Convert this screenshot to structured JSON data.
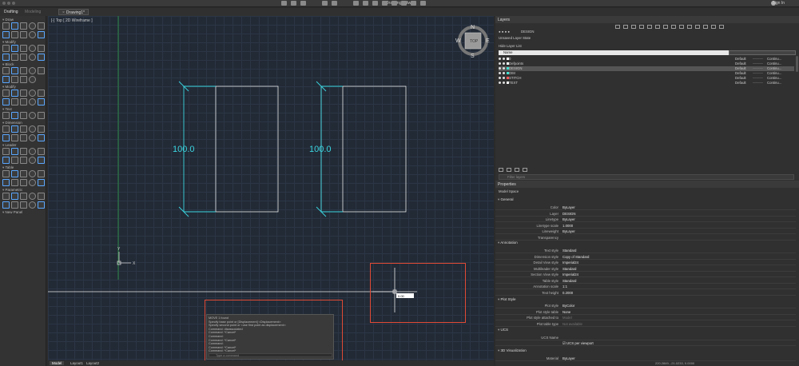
{
  "window": {
    "title": "Drawing1.dwg",
    "sign_in": "Sign In"
  },
  "workspace_tabs": [
    "Drafting",
    "Modeling"
  ],
  "document_tab": "Drawing1*",
  "viewport_label": "[-] Top [ 2D Wireframe ]",
  "viewcube": {
    "face": "TOP",
    "north": "N",
    "south": "S",
    "east": "E",
    "west": "W"
  },
  "dimensions": [
    {
      "text": "100.0"
    },
    {
      "text": "100.0"
    }
  ],
  "ucs": {
    "x": "X",
    "y": "Y"
  },
  "cursor_tooltip": "0.00",
  "tool_palette": {
    "sections": [
      "Draw",
      "Modify",
      "Block",
      "Modify",
      "Text",
      "Dimension",
      "Leader",
      "Table",
      "Parametric",
      "New Panel"
    ]
  },
  "command_history": [
    "MOVE 1 found",
    "Specify base point or [Displacement] <Displacement>:",
    "Specify second point or <use first point as displacement>:",
    "Command: disassociated",
    "Command: *Cancel*",
    "Command:",
    "Command: *Cancel*",
    "Command:",
    "Command: *Cancel*",
    "Command: *Cancel*",
    "Command: *Cancel*"
  ],
  "command_placeholder": "Type a command",
  "layout_tabs": [
    "Model",
    "Layout1",
    "Layout2"
  ],
  "layers": {
    "title": "Layers",
    "current_layer": "DESIGN",
    "unsaved_state": "Unsaved Layer State",
    "hide_layer_list": "Hide Layer List",
    "column_name": "Name",
    "search_placeholder": "Filter layers",
    "rows": [
      {
        "name": "0",
        "linetype": "Default",
        "style": "Continu...",
        "selected": false,
        "color": "#ffffff"
      },
      {
        "name": "Defpoints",
        "linetype": "Default",
        "style": "Continu...",
        "selected": false,
        "color": "#ffffff"
      },
      {
        "name": "DESIGN",
        "linetype": "Default",
        "style": "Continu...",
        "selected": true,
        "color": "#40e0d0"
      },
      {
        "name": "DIM",
        "linetype": "Default",
        "style": "Continu...",
        "selected": false,
        "color": "#40e0d0"
      },
      {
        "name": "STITCH",
        "linetype": "Default",
        "style": "Continu...",
        "selected": false,
        "color": "#ff5555"
      },
      {
        "name": "TEXT",
        "linetype": "Default",
        "style": "Continu...",
        "selected": false,
        "color": "#ffffff"
      }
    ]
  },
  "properties": {
    "title": "Properties",
    "context": "Model Space",
    "general_title": "General",
    "general": [
      {
        "label": "Color",
        "value": "ByLayer"
      },
      {
        "label": "Layer",
        "value": "DESIGN"
      },
      {
        "label": "Linetype",
        "value": "ByLayer"
      },
      {
        "label": "Linetype scale",
        "value": "1.0000"
      },
      {
        "label": "Lineweight",
        "value": "ByLayer"
      },
      {
        "label": "Transparency",
        "value": ""
      }
    ],
    "annotation_title": "Annotation",
    "annotation": [
      {
        "label": "Text style",
        "value": "Standard"
      },
      {
        "label": "Dimension style",
        "value": "Copy of Standard"
      },
      {
        "label": "Detail View style",
        "value": "Imperial24"
      },
      {
        "label": "Multileader style",
        "value": "Standard"
      },
      {
        "label": "Section View style",
        "value": "Imperial24"
      },
      {
        "label": "Table style",
        "value": "Standard"
      },
      {
        "label": "Annotation scale",
        "value": "1:1"
      },
      {
        "label": "Text height",
        "value": "0.2000"
      }
    ],
    "plot_title": "Plot Style",
    "plot": [
      {
        "label": "Plot style",
        "value": "ByColor"
      },
      {
        "label": "Plot style table",
        "value": "None"
      },
      {
        "label": "Plot style attached to",
        "value": "Model"
      },
      {
        "label": "Plot table type",
        "value": "Not available"
      }
    ],
    "ucs_title": "UCS",
    "ucs_name_label": "UCS Name",
    "ucs_per_viewport": "UCS per viewport",
    "viz_title": "3D Visualization",
    "material_label": "Material",
    "material_value": "ByLayer"
  },
  "coords": "220.2849, -21.0233, 0.0000"
}
